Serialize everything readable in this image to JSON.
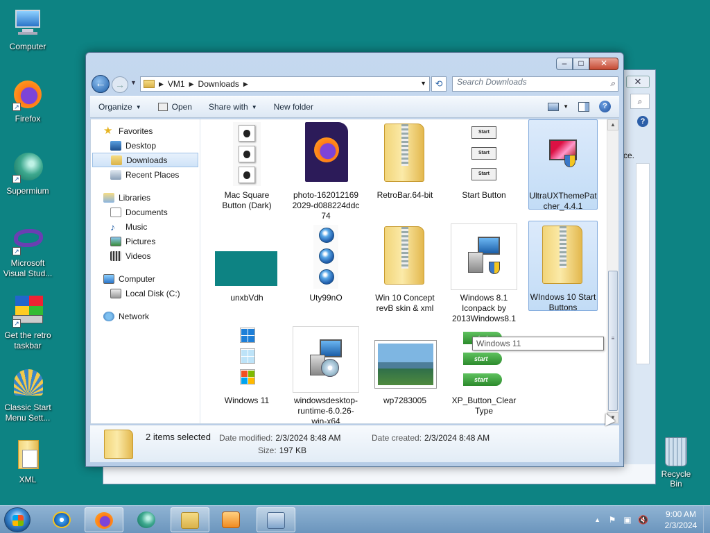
{
  "desktop": {
    "icons": [
      {
        "label": "Computer",
        "icon": "computer-icon"
      },
      {
        "label": "Firefox",
        "icon": "firefox-icon"
      },
      {
        "label": "Supermium",
        "icon": "supermium-icon"
      },
      {
        "label": "Microsoft Visual Stud...",
        "icon": "visual-studio-icon"
      },
      {
        "label": "Get the retro taskbar",
        "icon": "retro-taskbar-icon"
      },
      {
        "label": "Classic Start Menu Sett...",
        "icon": "classic-start-icon"
      },
      {
        "label": "XML",
        "icon": "xml-file-icon"
      }
    ],
    "recycle_bin": "Recycle Bin"
  },
  "background_window": {
    "partial_text": "ce."
  },
  "explorer": {
    "breadcrumb": [
      "VM1",
      "Downloads"
    ],
    "search_placeholder": "Search Downloads",
    "toolbar": {
      "organize": "Organize",
      "open": "Open",
      "share_with": "Share with",
      "new_folder": "New folder"
    },
    "nav": {
      "favorites": "Favorites",
      "desktop": "Desktop",
      "downloads": "Downloads",
      "recent_places": "Recent Places",
      "libraries": "Libraries",
      "documents": "Documents",
      "music": "Music",
      "pictures": "Pictures",
      "videos": "Videos",
      "computer": "Computer",
      "local_disk": "Local Disk (C:)",
      "network": "Network"
    },
    "files": [
      {
        "name": "Mac Square Button (Dark)",
        "selected": false
      },
      {
        "name": "photo-1620121692029-d088224ddc74",
        "selected": false
      },
      {
        "name": "RetroBar.64-bit",
        "selected": false
      },
      {
        "name": "Start Button",
        "selected": false
      },
      {
        "name": "UltraUXThemePatcher_4.4.1",
        "selected": true
      },
      {
        "name": "unxbVdh",
        "selected": false
      },
      {
        "name": "Uty99nO",
        "selected": false
      },
      {
        "name": "Win 10 Concept revB skin & xml",
        "selected": false
      },
      {
        "name": "Windows 8.1 Iconpack by 2013Windows8.1",
        "selected": false
      },
      {
        "name": "WIndows 10 Start Buttons",
        "selected": true
      },
      {
        "name": "Windows 11",
        "selected": false
      },
      {
        "name": "windowsdesktop-runtime-6.0.26-win-x64",
        "selected": false
      },
      {
        "name": "wp7283005",
        "selected": false
      },
      {
        "name": "XP_Button_ClearType",
        "selected": false
      }
    ],
    "tooltip": "Windows 11",
    "details": {
      "selection": "2 items selected",
      "date_modified_label": "Date modified:",
      "date_modified": "2/3/2024 8:48 AM",
      "date_created_label": "Date created:",
      "date_created": "2/3/2024 8:48 AM",
      "size_label": "Size:",
      "size": "197 KB"
    }
  },
  "taskbar": {
    "time": "9:00 AM",
    "date": "2/3/2024"
  }
}
